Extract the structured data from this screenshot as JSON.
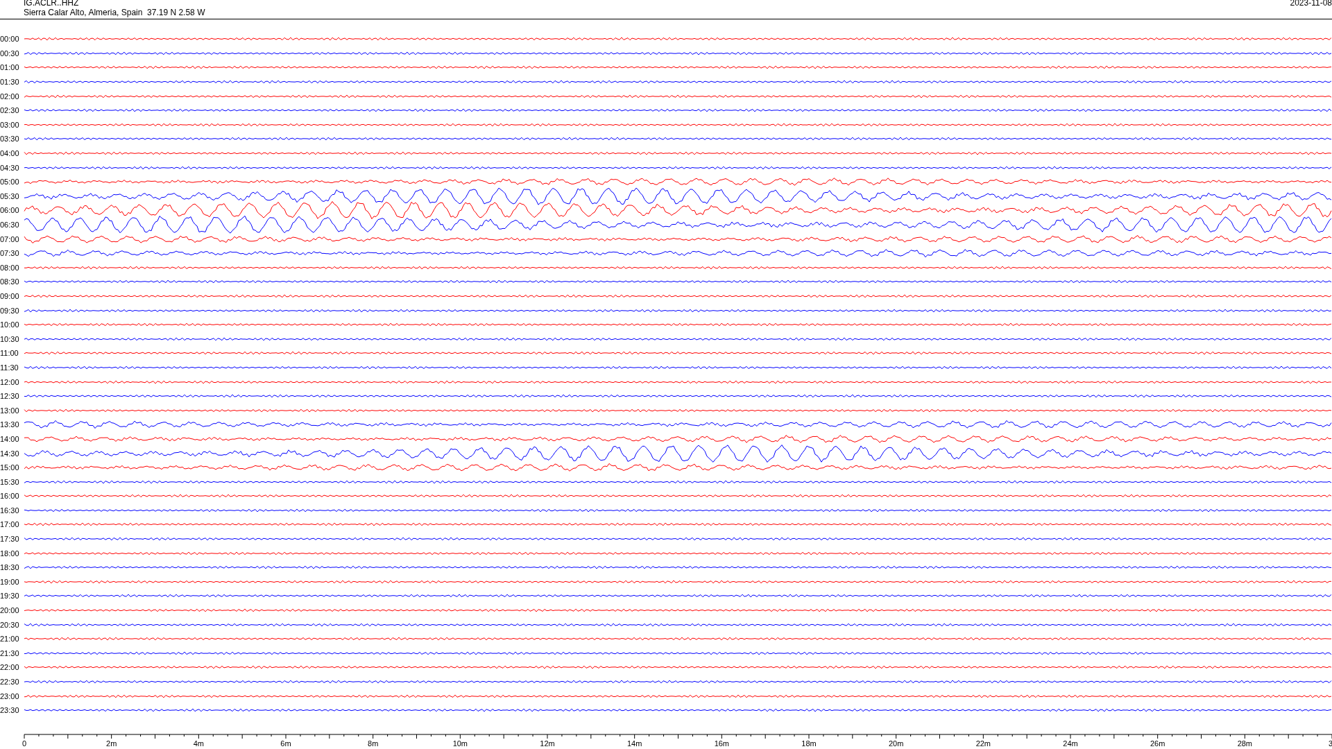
{
  "header": {
    "station": "IG.ACLR..HHZ",
    "location": "Sierra Calar Alto, Almeria, Spain  37.19 N 2.58 W",
    "date": "2023-11-08"
  },
  "traces": [
    {
      "label": "00:00",
      "color": "#ff0000",
      "kind": "quiet"
    },
    {
      "label": "00:30",
      "color": "#0000ff",
      "kind": "quiet"
    },
    {
      "label": "01:00",
      "color": "#ff0000",
      "kind": "quiet"
    },
    {
      "label": "01:30",
      "color": "#0000ff",
      "kind": "quiet"
    },
    {
      "label": "02:00",
      "color": "#ff0000",
      "kind": "quiet"
    },
    {
      "label": "02:30",
      "color": "#0000ff",
      "kind": "quiet"
    },
    {
      "label": "03:00",
      "color": "#ff0000",
      "kind": "quiet"
    },
    {
      "label": "03:30",
      "color": "#0000ff",
      "kind": "quiet"
    },
    {
      "label": "04:00",
      "color": "#ff0000",
      "kind": "quiet"
    },
    {
      "label": "04:30",
      "color": "#0000ff",
      "kind": "quiet"
    },
    {
      "label": "05:00",
      "color": "#ff0000",
      "kind": "moderate"
    },
    {
      "label": "05:30",
      "color": "#0000ff",
      "kind": "strong"
    },
    {
      "label": "06:00",
      "color": "#ff0000",
      "kind": "strong"
    },
    {
      "label": "06:30",
      "color": "#0000ff",
      "kind": "strong"
    },
    {
      "label": "07:00",
      "color": "#ff0000",
      "kind": "moderate"
    },
    {
      "label": "07:30",
      "color": "#0000ff",
      "kind": "moderate"
    },
    {
      "label": "08:00",
      "color": "#ff0000",
      "kind": "quiet"
    },
    {
      "label": "08:30",
      "color": "#0000ff",
      "kind": "quiet"
    },
    {
      "label": "09:00",
      "color": "#ff0000",
      "kind": "quiet"
    },
    {
      "label": "09:30",
      "color": "#0000ff",
      "kind": "quiet"
    },
    {
      "label": "10:00",
      "color": "#ff0000",
      "kind": "quiet"
    },
    {
      "label": "10:30",
      "color": "#0000ff",
      "kind": "quiet"
    },
    {
      "label": "11:00",
      "color": "#ff0000",
      "kind": "quiet"
    },
    {
      "label": "11:30",
      "color": "#0000ff",
      "kind": "quiet"
    },
    {
      "label": "12:00",
      "color": "#ff0000",
      "kind": "quiet"
    },
    {
      "label": "12:30",
      "color": "#0000ff",
      "kind": "quiet"
    },
    {
      "label": "13:00",
      "color": "#ff0000",
      "kind": "quiet"
    },
    {
      "label": "13:30",
      "color": "#0000ff",
      "kind": "moderate"
    },
    {
      "label": "14:00",
      "color": "#ff0000",
      "kind": "moderate"
    },
    {
      "label": "14:30",
      "color": "#0000ff",
      "kind": "strong"
    },
    {
      "label": "15:00",
      "color": "#ff0000",
      "kind": "moderate"
    },
    {
      "label": "15:30",
      "color": "#0000ff",
      "kind": "quiet"
    },
    {
      "label": "16:00",
      "color": "#ff0000",
      "kind": "quiet"
    },
    {
      "label": "16:30",
      "color": "#0000ff",
      "kind": "quiet"
    },
    {
      "label": "17:00",
      "color": "#ff0000",
      "kind": "quiet"
    },
    {
      "label": "17:30",
      "color": "#0000ff",
      "kind": "quiet"
    },
    {
      "label": "18:00",
      "color": "#ff0000",
      "kind": "quiet"
    },
    {
      "label": "18:30",
      "color": "#0000ff",
      "kind": "quiet"
    },
    {
      "label": "19:00",
      "color": "#ff0000",
      "kind": "quiet"
    },
    {
      "label": "19:30",
      "color": "#0000ff",
      "kind": "quiet"
    },
    {
      "label": "20:00",
      "color": "#ff0000",
      "kind": "quiet"
    },
    {
      "label": "20:30",
      "color": "#0000ff",
      "kind": "quiet"
    },
    {
      "label": "21:00",
      "color": "#ff0000",
      "kind": "quiet"
    },
    {
      "label": "21:30",
      "color": "#0000ff",
      "kind": "quiet"
    },
    {
      "label": "22:00",
      "color": "#ff0000",
      "kind": "quiet"
    },
    {
      "label": "22:30",
      "color": "#0000ff",
      "kind": "quiet"
    },
    {
      "label": "23:00",
      "color": "#ff0000",
      "kind": "quiet"
    },
    {
      "label": "23:30",
      "color": "#0000ff",
      "kind": "quiet"
    }
  ],
  "time_axis": {
    "labels": [
      "0",
      "2m",
      "4m",
      "6m",
      "8m",
      "10m",
      "12m",
      "14m",
      "16m",
      "18m",
      "20m",
      "22m",
      "24m",
      "26m",
      "28m",
      "3"
    ]
  }
}
